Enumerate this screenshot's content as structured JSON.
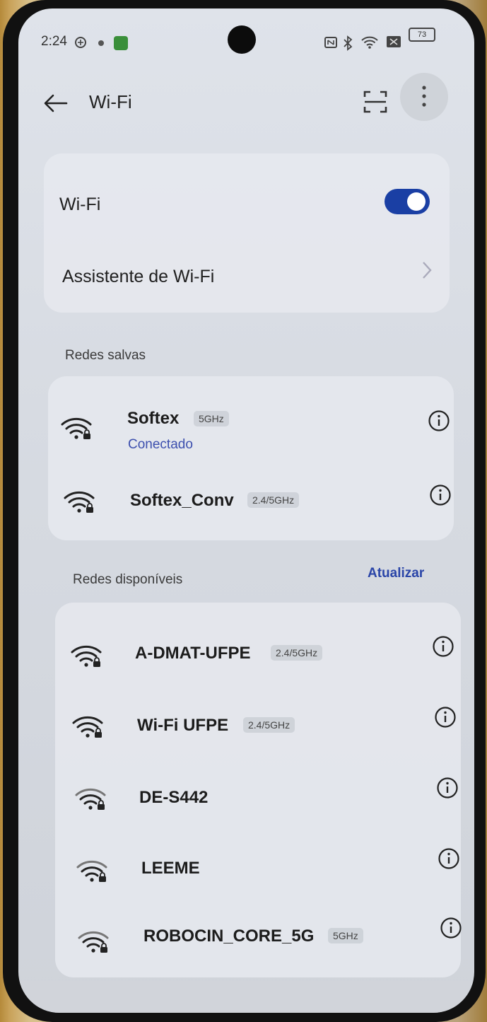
{
  "status_bar": {
    "time": "2:24",
    "battery": "73",
    "icons": [
      "vpn-icon",
      "notification-icon",
      "app-icon",
      "nfc-icon",
      "bluetooth-icon",
      "wifi-icon",
      "sim-icon",
      "battery-icon"
    ]
  },
  "app_bar": {
    "title": "Wi-Fi",
    "icons": [
      "back-arrow-icon",
      "scan-icon",
      "more-vert-icon"
    ]
  },
  "main_card": {
    "wifi_label": "Wi-Fi",
    "wifi_enabled": true,
    "assistant_label": "Assistente de Wi-Fi"
  },
  "saved_section": {
    "title": "Redes salvas",
    "networks": [
      {
        "name": "Softex",
        "band": "5GHz",
        "status": "Conectado",
        "locked": true
      },
      {
        "name": "Softex_Conv",
        "band": "2.4/5GHz",
        "status": "",
        "locked": true
      }
    ]
  },
  "available_section": {
    "title": "Redes disponíveis",
    "refresh_label": "Atualizar",
    "networks": [
      {
        "name": "A-DMAT-UFPE",
        "band": "2.4/5GHz",
        "locked": true
      },
      {
        "name": "Wi-Fi UFPE",
        "band": "2.4/5GHz",
        "locked": true
      },
      {
        "name": "DE-S442",
        "band": "",
        "locked": true
      },
      {
        "name": "LEEME",
        "band": "",
        "locked": true
      },
      {
        "name": "ROBOCIN_CORE_5G",
        "band": "5GHz",
        "locked": true
      }
    ]
  },
  "colors": {
    "accent": "#1a3fa4",
    "link": "#2a45a8",
    "connected": "#3c4fae"
  }
}
